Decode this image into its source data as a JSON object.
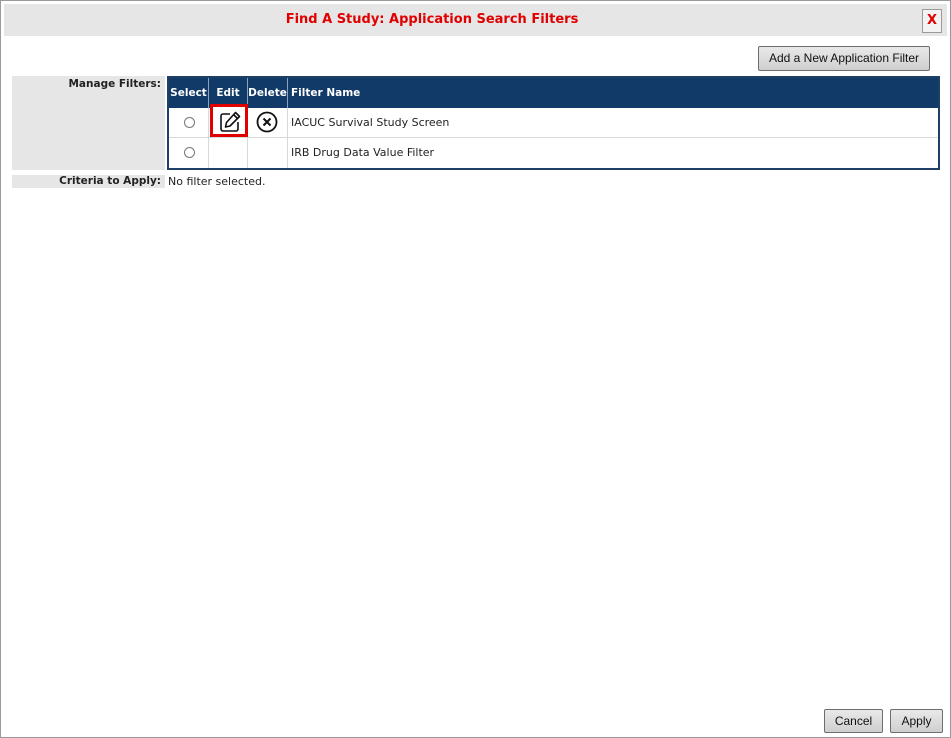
{
  "dialog": {
    "title": "Find A Study: Application Search Filters",
    "close_label": "X"
  },
  "toolbar": {
    "add_filter_label": "Add a New Application Filter"
  },
  "manage": {
    "label": "Manage Filters:",
    "columns": [
      "Select",
      "Edit",
      "Delete",
      "Filter Name"
    ],
    "rows": [
      {
        "name": "IACUC Survival Study Screen",
        "has_edit": true,
        "has_delete": true
      },
      {
        "name": "IRB Drug Data Value Filter",
        "has_edit": false,
        "has_delete": false
      }
    ]
  },
  "criteria": {
    "label": "Criteria to Apply:",
    "value": "No filter selected."
  },
  "footer": {
    "cancel_label": "Cancel",
    "apply_label": "Apply"
  },
  "colors": {
    "title_red": "#e00000",
    "header_navy": "#123a68",
    "highlight_red": "#e00000"
  },
  "icons": {
    "edit": "edit-pencil-icon",
    "delete": "circle-x-icon",
    "close": "close-icon"
  }
}
